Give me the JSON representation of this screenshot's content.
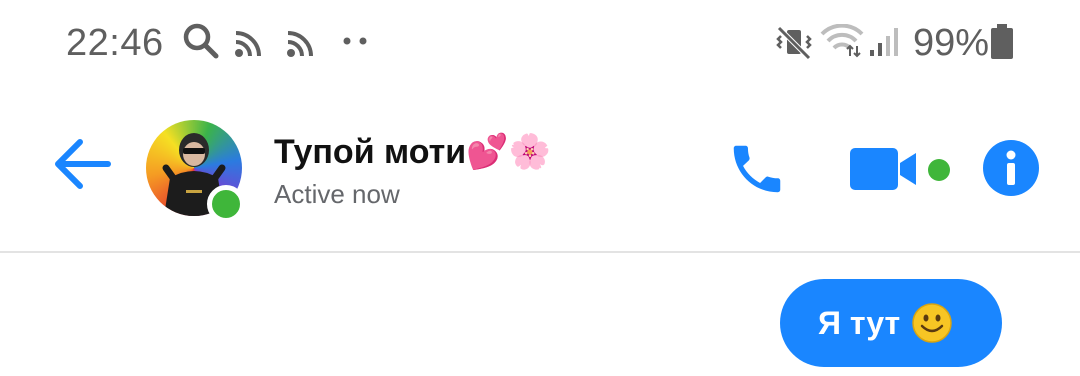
{
  "status_bar": {
    "time": "22:46",
    "battery": "99%",
    "icons": [
      "search-icon",
      "rss-icon",
      "rss-icon",
      "more-dots-icon",
      "vibrate-mute-icon",
      "wifi-icon",
      "signal-icon",
      "battery-icon"
    ]
  },
  "header": {
    "back_icon": "arrow-left-icon",
    "contact_name": "Тупой моти",
    "contact_name_emoji": "💕🌸",
    "contact_status": "Active now",
    "actions": [
      "phone-icon",
      "video-camera-icon",
      "info-icon"
    ]
  },
  "messages": [
    {
      "text": "Я тут",
      "emoji": "smiley-face-icon",
      "from": "me"
    }
  ],
  "colors": {
    "accent": "#1a86ff",
    "presence": "#3fb63a",
    "status_text": "#5f5f5f",
    "divider": "#e3e3e3"
  }
}
